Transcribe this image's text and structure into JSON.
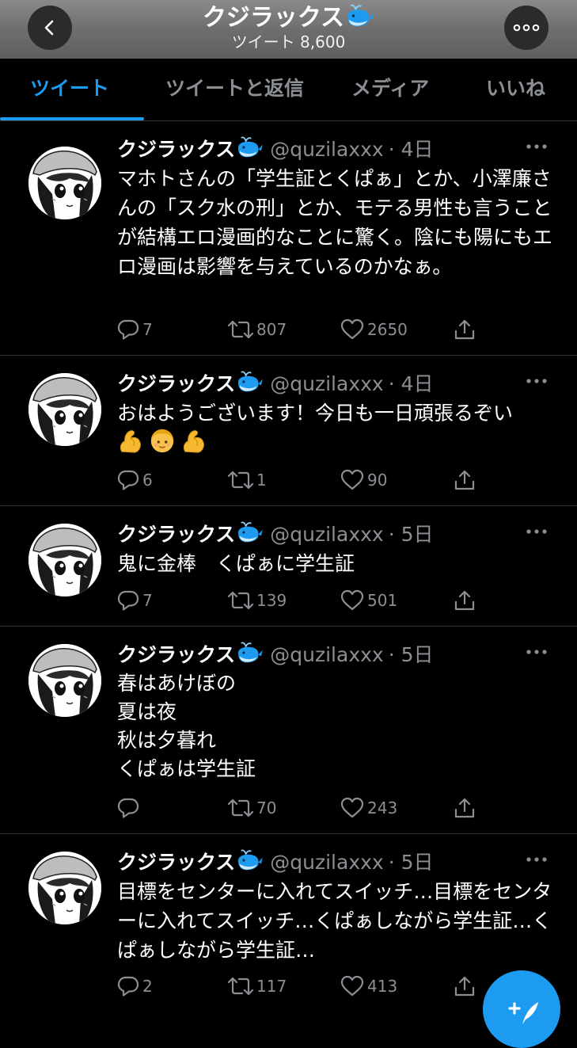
{
  "header": {
    "title": "クジラックス",
    "tweet_count_label": "ツイート 8,600",
    "back_icon": "chevron-left-icon",
    "more_icon": "more-circle-icon"
  },
  "tabs": [
    {
      "label": "ツイート",
      "active": true
    },
    {
      "label": "ツイートと返信",
      "active": false
    },
    {
      "label": "メディア",
      "active": false
    },
    {
      "label": "いいね",
      "active": false
    }
  ],
  "colors": {
    "accent": "#1d9bf0",
    "muted": "#8b8f94",
    "divider": "#2f3336"
  },
  "tweets": [
    {
      "name": "クジラックス",
      "handle": "@quzilaxxx",
      "time": "· 4日",
      "text": "マホトさんの「学生証とくぱぁ」とか、小澤廉さんの「スク水の刑」とか、モテる男性も言うことが結構エロ漫画的なことに驚く。陰にも陽にもエロ漫画は影響を与えているのかなぁ。",
      "replies": "7",
      "retweets": "807",
      "likes": "2650"
    },
    {
      "name": "クジラックス",
      "handle": "@quzilaxxx",
      "time": "· 4日",
      "text": "おはようございます！今日も一日頑張るぞい",
      "emojis": [
        "flexed-biceps",
        "girl",
        "flexed-biceps"
      ],
      "replies": "6",
      "retweets": "1",
      "likes": "90"
    },
    {
      "name": "クジラックス",
      "handle": "@quzilaxxx",
      "time": "· 5日",
      "text": "鬼に金棒　くぱぁに学生証",
      "replies": "7",
      "retweets": "139",
      "likes": "501"
    },
    {
      "name": "クジラックス",
      "handle": "@quzilaxxx",
      "time": "· 5日",
      "text": "春はあけぼの\n夏は夜\n秋は夕暮れ\nくぱぁは学生証",
      "replies": "",
      "retweets": "70",
      "likes": "243"
    },
    {
      "name": "クジラックス",
      "handle": "@quzilaxxx",
      "time": "· 5日",
      "text": "目標をセンターに入れてスイッチ…目標をセンターに入れてスイッチ…くぱぁしながら学生証…くぱぁしながら学生証…",
      "replies": "2",
      "retweets": "117",
      "likes": "413"
    }
  ],
  "fab": {
    "icon": "compose-tweet-icon"
  }
}
